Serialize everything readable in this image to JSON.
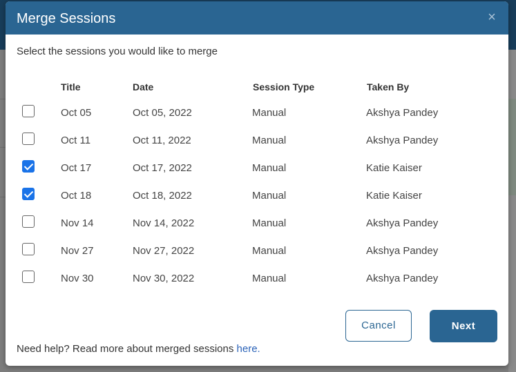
{
  "dialog": {
    "title": "Merge Sessions",
    "close_symbol": "×",
    "intro": "Select the sessions you would like to merge",
    "columns": {
      "title": "Title",
      "date": "Date",
      "session_type": "Session Type",
      "taken_by": "Taken By"
    },
    "rows": [
      {
        "title": "Oct 05",
        "date": "Oct 05, 2022",
        "type": "Manual",
        "taken_by": "Akshya Pandey",
        "checked": false
      },
      {
        "title": "Oct 11",
        "date": "Oct 11, 2022",
        "type": "Manual",
        "taken_by": "Akshya Pandey",
        "checked": false
      },
      {
        "title": "Oct 17",
        "date": "Oct 17, 2022",
        "type": "Manual",
        "taken_by": "Katie Kaiser",
        "checked": true
      },
      {
        "title": "Oct 18",
        "date": "Oct 18, 2022",
        "type": "Manual",
        "taken_by": "Katie Kaiser",
        "checked": true
      },
      {
        "title": "Nov 14",
        "date": "Nov 14, 2022",
        "type": "Manual",
        "taken_by": "Akshya Pandey",
        "checked": false
      },
      {
        "title": "Nov 27",
        "date": "Nov 27, 2022",
        "type": "Manual",
        "taken_by": "Akshya Pandey",
        "checked": false
      },
      {
        "title": "Nov 30",
        "date": "Nov 30, 2022",
        "type": "Manual",
        "taken_by": "Akshya Pandey",
        "checked": false
      }
    ],
    "cancel_label": "Cancel",
    "next_label": "Next",
    "help_text": "Need help? Read more about merged sessions ",
    "help_link": "here."
  },
  "colors": {
    "header": "#2a6592",
    "checkbox_checked": "#1a73e8",
    "link": "#2a62b8"
  },
  "icons": {
    "close": "close-icon",
    "checkbox": "checkbox-icon"
  }
}
